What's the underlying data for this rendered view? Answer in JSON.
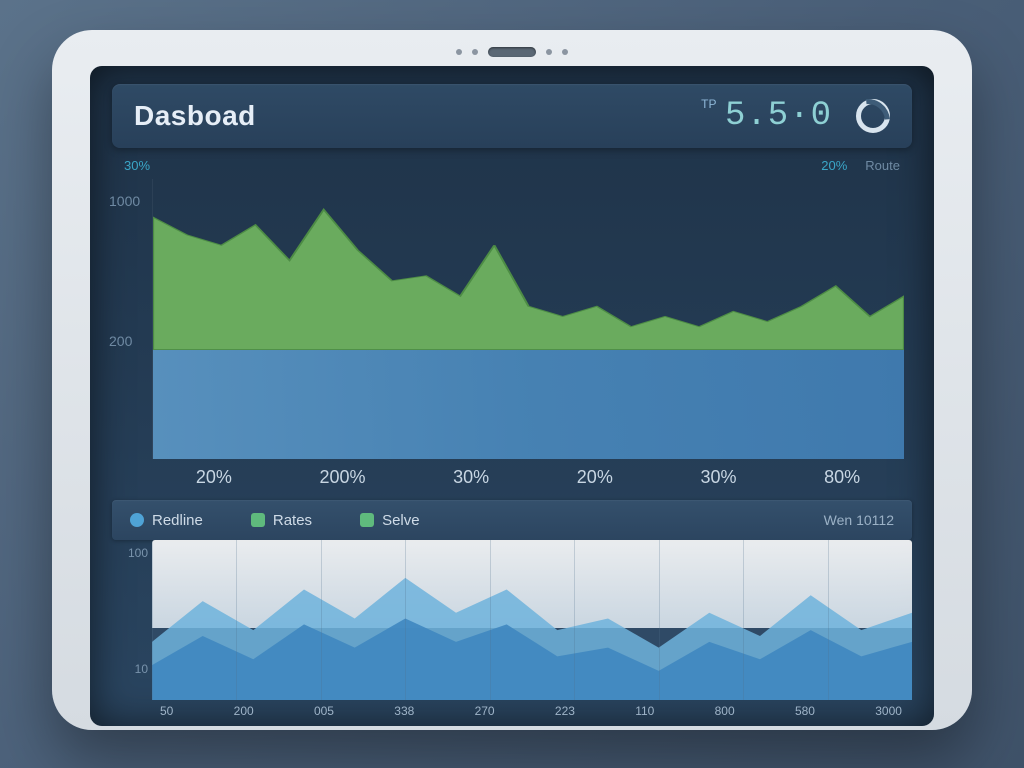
{
  "header": {
    "title": "Dasboad",
    "metric_prefix": "TP",
    "metric_value": "5.5·0",
    "stat_left": "30%",
    "stat_pct": "20%",
    "stat_label": "Route"
  },
  "legend": {
    "items": [
      {
        "label": "Redline",
        "dot": "circle"
      },
      {
        "label": "Rates",
        "dot": "green"
      },
      {
        "label": "Selve",
        "dot": "green"
      }
    ],
    "right_text": "Wen 10112"
  },
  "colors": {
    "green": "#6aab5e",
    "green_dark": "#5b9a52",
    "blue1": "#5d99c8",
    "blue2": "#4280b7",
    "accent": "#3aa6c7",
    "panel": "#2a4560"
  },
  "chart_data": [
    {
      "type": "area",
      "title": "",
      "xlabel": "",
      "ylabel": "",
      "y_ticks": [
        200,
        1000
      ],
      "ylim": [
        0,
        1100
      ],
      "x_categories": [
        "20%",
        "200%",
        "30%",
        "20%",
        "30%",
        "80%"
      ],
      "series": [
        {
          "name": "green-area",
          "values": [
            950,
            880,
            840,
            920,
            780,
            980,
            820,
            700,
            720,
            640,
            840,
            600,
            560,
            600,
            520,
            560,
            520,
            580,
            540,
            600,
            680,
            560,
            640
          ]
        }
      ],
      "baseline_y": 430,
      "blue_band": {
        "y0": 0,
        "y1": 430
      }
    },
    {
      "type": "area",
      "title": "",
      "y_ticks": [
        10,
        100
      ],
      "ylim": [
        0,
        110
      ],
      "x_categories": [
        "50",
        "200",
        "005",
        "338",
        "270",
        "223",
        "110",
        "800",
        "580",
        "3000"
      ],
      "series": [
        {
          "name": "series-a",
          "values": [
            40,
            68,
            48,
            76,
            56,
            84,
            60,
            76,
            48,
            56,
            36,
            60,
            44,
            72,
            48,
            60
          ]
        },
        {
          "name": "series-b",
          "values": [
            24,
            44,
            28,
            52,
            36,
            56,
            40,
            52,
            30,
            36,
            20,
            40,
            28,
            48,
            30,
            40
          ]
        }
      ]
    }
  ]
}
